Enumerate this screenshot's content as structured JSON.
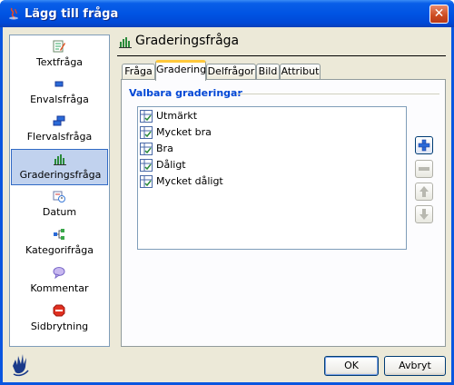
{
  "window": {
    "title": "Lägg till fråga",
    "close_label": "✕"
  },
  "sidebar": {
    "items": [
      {
        "label": "Textfråga",
        "icon": "text-question-icon"
      },
      {
        "label": "Envalsfråga",
        "icon": "single-choice-icon"
      },
      {
        "label": "Flervalsfråga",
        "icon": "multi-choice-icon"
      },
      {
        "label": "Graderingsfråga",
        "icon": "rating-question-icon",
        "selected": true
      },
      {
        "label": "Datum",
        "icon": "date-icon"
      },
      {
        "label": "Kategorifråga",
        "icon": "category-icon"
      },
      {
        "label": "Kommentar",
        "icon": "comment-icon"
      },
      {
        "label": "Sidbrytning",
        "icon": "page-break-icon"
      }
    ]
  },
  "header": {
    "title": "Graderingsfråga"
  },
  "tabs": [
    {
      "label": "Fråga"
    },
    {
      "label": "Gradering",
      "active": true
    },
    {
      "label": "Delfrågor"
    },
    {
      "label": "Bild"
    },
    {
      "label": "Attribut"
    }
  ],
  "panel": {
    "group_title": "Valbara graderingar",
    "items": [
      "Utmärkt",
      "Mycket bra",
      "Bra",
      "Dåligt",
      "Mycket dåligt"
    ]
  },
  "footer": {
    "ok_label": "OK",
    "cancel_label": "Avbryt"
  },
  "colors": {
    "titlebar": "#0054e3",
    "selection": "#c1d2ee",
    "group_title": "#0046d5",
    "tab_highlight": "#ffc83c"
  }
}
